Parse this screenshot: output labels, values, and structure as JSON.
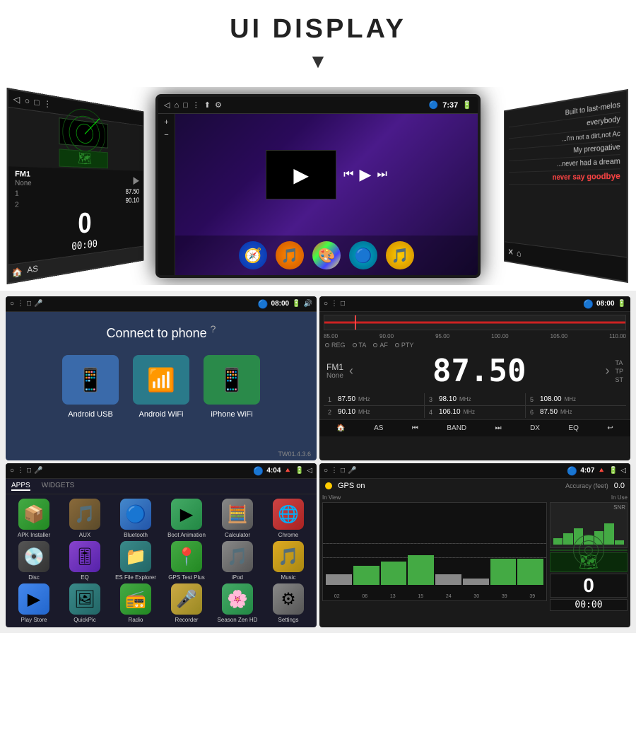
{
  "header": {
    "title": "UI DISPLAY",
    "arrow": "▼"
  },
  "car_unit": {
    "status_bar": {
      "time": "7:37",
      "icons": [
        "◁",
        "○",
        "□",
        "⋮",
        "⚙",
        "📶",
        "🔵"
      ]
    },
    "left_panel": {
      "fm_label": "FM1",
      "fm_sub": "None",
      "freq1_num": "1",
      "freq1_val": "87.50",
      "freq2_num": "2",
      "freq2_val": "90.10",
      "zero": "0",
      "timer": "00:00",
      "as_label": "AS"
    },
    "right_panel": {
      "lines": [
        "Built to last-melos",
        "everybody",
        "I'm not a dirt,not Ac...",
        "My prerogative",
        "never had a dream...",
        "never say goodbye"
      ]
    }
  },
  "panels": {
    "connect": {
      "title": "Connect to phone",
      "help_icon": "?",
      "options": [
        {
          "label": "Android USB",
          "icon": "📱"
        },
        {
          "label": "Android WiFi",
          "icon": "📶"
        },
        {
          "label": "iPhone WiFi",
          "icon": "📱"
        }
      ],
      "version": "TW01.4.3.6"
    },
    "radio": {
      "freq_marks": [
        "85.00",
        "90.00",
        "95.00",
        "100.00",
        "105.00",
        "110.00"
      ],
      "options": [
        "REG",
        "TA",
        "AF",
        "PTY"
      ],
      "fm_label": "FM1",
      "station": "None",
      "frequency": "87.50",
      "ta": "TA",
      "tp": "TP",
      "st": "ST",
      "presets": [
        {
          "num": "1",
          "freq": "87.50",
          "mhz": "MHz"
        },
        {
          "num": "3",
          "freq": "98.10",
          "mhz": "MHz"
        },
        {
          "num": "5",
          "freq": "108.00",
          "mhz": "MHz"
        },
        {
          "num": "2",
          "freq": "90.10",
          "mhz": "MHz"
        },
        {
          "num": "4",
          "freq": "106.10",
          "mhz": "MHz"
        },
        {
          "num": "6",
          "freq": "87.50",
          "mhz": "MHz"
        }
      ],
      "bottom_buttons": [
        "🏠",
        "AS",
        "⏮",
        "BAND",
        "⏭",
        "DX",
        "EQ",
        "↩"
      ]
    },
    "apps": {
      "tabs": [
        "APPS",
        "WIDGETS"
      ],
      "apps": [
        {
          "name": "APK Installer",
          "icon": "📦",
          "class": "ai-green"
        },
        {
          "name": "AUX",
          "icon": "🎵",
          "class": "ai-brown"
        },
        {
          "name": "Bluetooth",
          "icon": "🔵",
          "class": "ai-blue"
        },
        {
          "name": "Boot Animation",
          "icon": "▶",
          "class": "ai-green2"
        },
        {
          "name": "Calculator",
          "icon": "🧮",
          "class": "ai-gray"
        },
        {
          "name": "Chrome",
          "icon": "🌐",
          "class": "ai-red"
        },
        {
          "name": "Disc",
          "icon": "💿",
          "class": "ai-darkgray"
        },
        {
          "name": "EQ",
          "icon": "🎚",
          "class": "ai-purple"
        },
        {
          "name": "ES File Explorer",
          "icon": "📁",
          "class": "ai-teal"
        },
        {
          "name": "GPS Test Plus",
          "icon": "📍",
          "class": "ai-green"
        },
        {
          "name": "iPod",
          "icon": "🎵",
          "class": "ai-gray"
        },
        {
          "name": "Music",
          "icon": "🎵",
          "class": "ai-yellow2"
        },
        {
          "name": "Play Store",
          "icon": "▶",
          "class": "ai-playstore"
        },
        {
          "name": "QuickPic",
          "icon": "🖼",
          "class": "ai-teal"
        },
        {
          "name": "Radio",
          "icon": "📻",
          "class": "ai-green"
        },
        {
          "name": "Recorder",
          "icon": "🎤",
          "class": "ai-camera"
        },
        {
          "name": "Season Zen HD",
          "icon": "🌸",
          "class": "ai-green2"
        },
        {
          "name": "Settings",
          "icon": "⚙",
          "class": "ai-gray"
        }
      ],
      "status_time": "4:04"
    },
    "gps": {
      "dot_color": "#ffcc00",
      "label": "GPS on",
      "accuracy_label": "Accuracy (feet)",
      "value": "0.0",
      "in_view": "In View",
      "in_use": "In Use",
      "bars": [
        20,
        28,
        34,
        44,
        20,
        10,
        39,
        39
      ],
      "x_labels": [
        "02",
        "06",
        "13",
        "15",
        "24",
        "30",
        "39",
        "39"
      ],
      "snr_bars": [
        15,
        25,
        35,
        20,
        30,
        45,
        10
      ],
      "status_time": "4:07",
      "zero": "0",
      "timer": "00:00",
      "snr_label": "SNR"
    }
  }
}
